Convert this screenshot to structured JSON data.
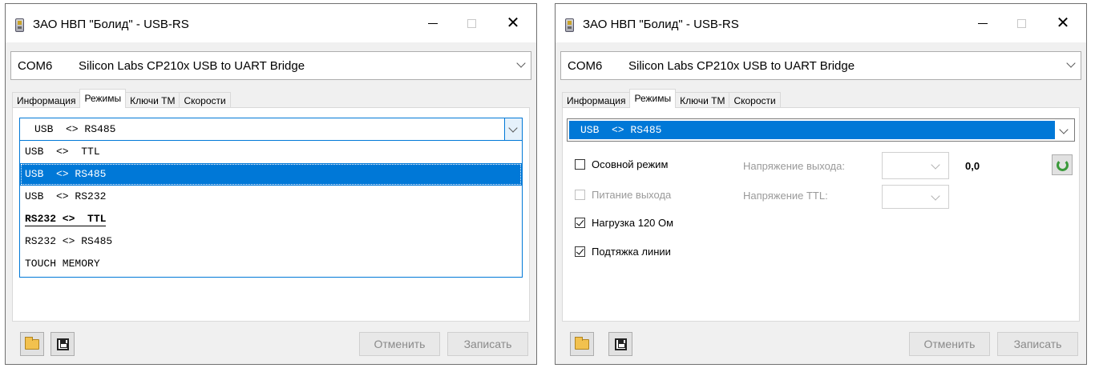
{
  "window": {
    "title": "ЗАО НВП \"Болид\" - USB-RS"
  },
  "port": {
    "name": "COM6",
    "device": "Silicon Labs CP210x USB to UART Bridge"
  },
  "tabs": [
    "Информация",
    "Режимы",
    "Ключи ТМ",
    "Скорости"
  ],
  "left": {
    "selected_mode": "USB  <> RS485",
    "dropdown_options": [
      "USB  <>  TTL",
      "USB  <> RS485",
      "USB  <> RS232",
      "RS232 <>  TTL",
      "RS232 <> RS485",
      "TOUCH MEMORY"
    ]
  },
  "right": {
    "selected_mode": "USB  <> RS485",
    "main_mode_label": "Осовной режим",
    "power_output_label": "Питание выхода",
    "load_label": "Нагрузка 120 Ом",
    "pullup_label": "Подтяжка линии",
    "output_voltage_label": "Напряжение выхода:",
    "ttl_voltage_label": "Напряжение TTL:",
    "voltage_value": "0,0"
  },
  "buttons": {
    "cancel": "Отменить",
    "write": "Записать"
  }
}
